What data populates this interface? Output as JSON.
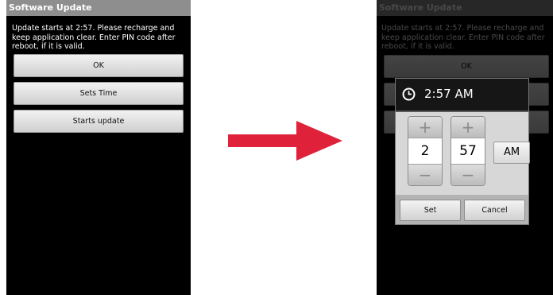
{
  "app": {
    "title": "Software Update"
  },
  "message": "Update starts at  2:57. Please recharge and keep application clear. Enter PIN code after reboot, if it is valid.",
  "buttons": {
    "ok": "OK",
    "sets_time": "Sets Time",
    "starts_update": "Starts update"
  },
  "time_dialog": {
    "title": "2:57 AM",
    "hour": "2",
    "minute": "57",
    "ampm": "AM",
    "plus_glyph": "+",
    "minus_glyph": "−",
    "set": "Set",
    "cancel": "Cancel"
  },
  "colors": {
    "arrow": "#e0213a",
    "titlebar": "#8e8e8e"
  },
  "icons": {
    "clock": "clock-icon",
    "transition_arrow": "arrow-right-icon"
  }
}
